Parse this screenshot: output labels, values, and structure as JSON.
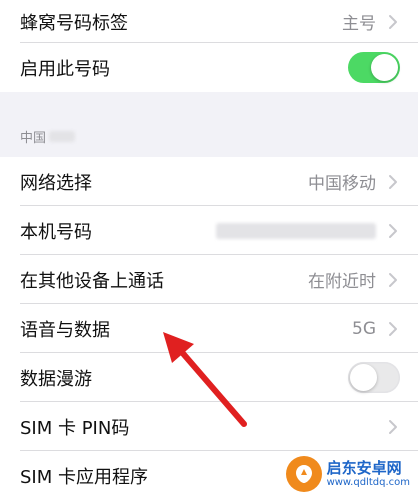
{
  "top_group": {
    "rows": [
      {
        "label": "蜂窝号码标签",
        "value": "主号"
      },
      {
        "label": "启用此号码",
        "toggle": true
      }
    ]
  },
  "section": {
    "header": "中国"
  },
  "carrier_group": {
    "rows": [
      {
        "label": "网络选择",
        "value": "中国移动"
      },
      {
        "label": "本机号码",
        "value": ""
      },
      {
        "label": "在其他设备上通话",
        "value": "在附近时"
      },
      {
        "label": "语音与数据",
        "value": "5G"
      },
      {
        "label": "数据漫游",
        "toggle": false
      },
      {
        "label": "SIM 卡 PIN码"
      },
      {
        "label": "SIM 卡应用程序"
      }
    ]
  },
  "watermark": {
    "title": "启东安卓网",
    "url": "www.qdltdq.com"
  },
  "colors": {
    "switch_on": "#4cd964",
    "switch_off": "#e9e9ea",
    "annotation_arrow": "#e02020",
    "section_background": "#f2f2f7",
    "watermark_blue": "#1e66c8",
    "watermark_orange": "#f08a1c"
  }
}
